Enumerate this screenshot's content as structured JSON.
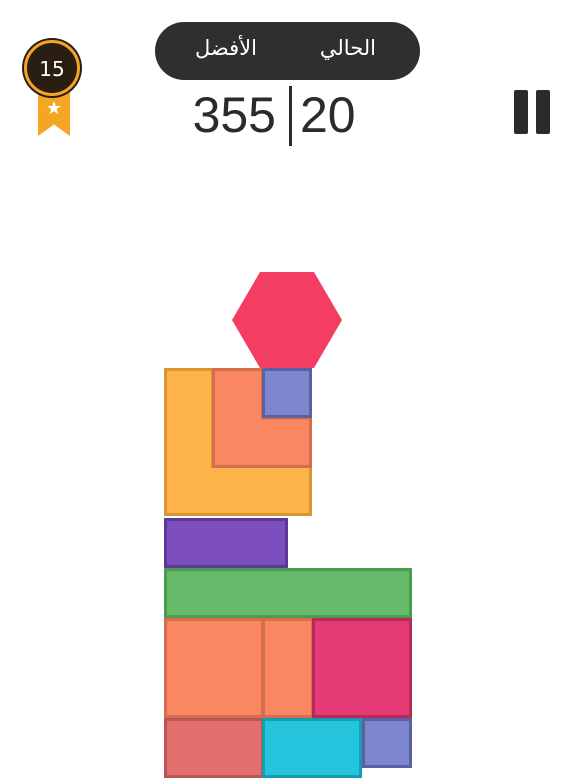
{
  "level": {
    "number": "15",
    "star": "★"
  },
  "score": {
    "best_label": "الأفضل",
    "current_label": "الحالي",
    "best_value": "355",
    "current_value": "20"
  },
  "colors": {
    "hexagon": "#f43d62",
    "orange_l": "#fdb34a",
    "salmon": "#fb8762",
    "indigo": "#7b86cf",
    "purple": "#7d4fbe",
    "green": "#65bb6a",
    "magenta": "#e63a75",
    "rose": "#e26e6e",
    "cyan": "#24c5dc"
  }
}
